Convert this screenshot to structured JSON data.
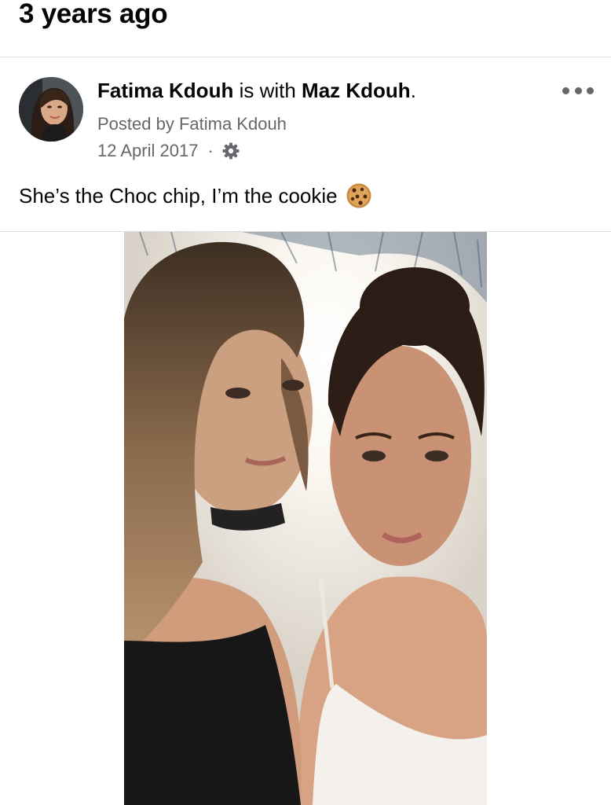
{
  "memory": {
    "title": "3 years ago"
  },
  "post": {
    "author": "Fatima Kdouh",
    "with_text": " is with ",
    "tagged": "Maz Kdouh",
    "period": ".",
    "posted_by": "Posted by Fatima Kdouh",
    "date": "12 April 2017",
    "separator": "·",
    "privacy_icon": "gear-icon",
    "caption": "She’s the Choc chip, I’m the cookie",
    "caption_emoji": "cookie-emoji",
    "more_icon": "more-options-icon"
  },
  "colors": {
    "primary_text": "#050505",
    "secondary_text": "#65676b",
    "divider": "#dcdde0"
  }
}
